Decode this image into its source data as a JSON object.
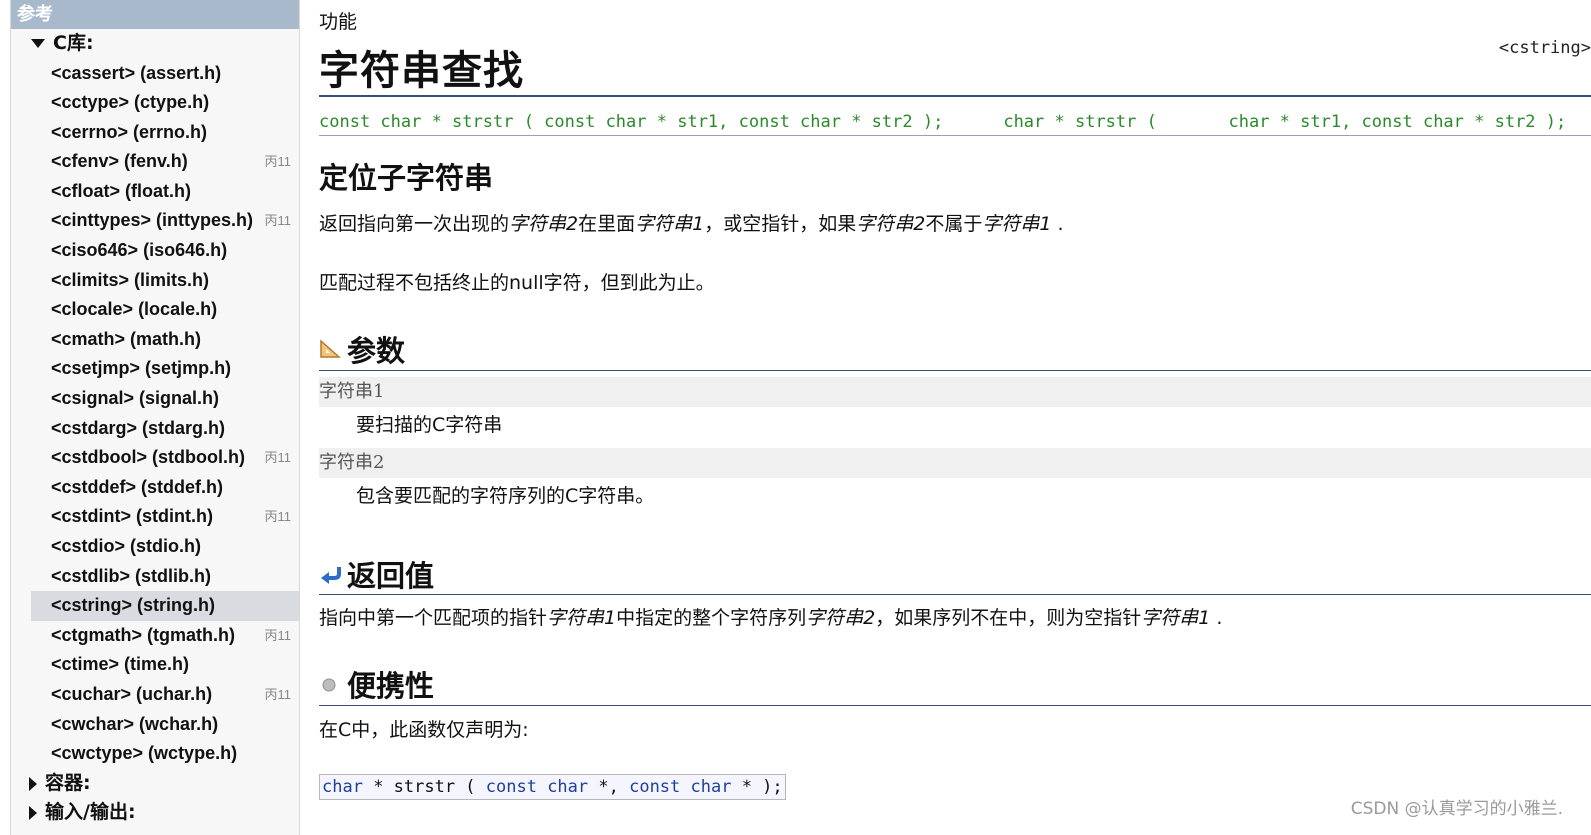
{
  "sidebar": {
    "header": "参考",
    "group_clib": "C库:",
    "items": [
      {
        "label": "<cassert> (assert.h)",
        "badge": ""
      },
      {
        "label": "<cctype> (ctype.h)",
        "badge": ""
      },
      {
        "label": "<cerrno> (errno.h)",
        "badge": ""
      },
      {
        "label": "<cfenv> (fenv.h)",
        "badge": "丙11"
      },
      {
        "label": "<cfloat> (float.h)",
        "badge": ""
      },
      {
        "label": "<cinttypes> (inttypes.h)",
        "badge": "丙11"
      },
      {
        "label": "<ciso646> (iso646.h)",
        "badge": ""
      },
      {
        "label": "<climits> (limits.h)",
        "badge": ""
      },
      {
        "label": "<clocale> (locale.h)",
        "badge": ""
      },
      {
        "label": "<cmath> (math.h)",
        "badge": ""
      },
      {
        "label": "<csetjmp> (setjmp.h)",
        "badge": ""
      },
      {
        "label": "<csignal> (signal.h)",
        "badge": ""
      },
      {
        "label": "<cstdarg> (stdarg.h)",
        "badge": ""
      },
      {
        "label": "<cstdbool> (stdbool.h)",
        "badge": "丙11"
      },
      {
        "label": "<cstddef> (stddef.h)",
        "badge": ""
      },
      {
        "label": "<cstdint> (stdint.h)",
        "badge": "丙11"
      },
      {
        "label": "<cstdio> (stdio.h)",
        "badge": ""
      },
      {
        "label": "<cstdlib> (stdlib.h)",
        "badge": ""
      },
      {
        "label": "<cstring> (string.h)",
        "badge": ""
      },
      {
        "label": "<ctgmath> (tgmath.h)",
        "badge": "丙11"
      },
      {
        "label": "<ctime> (time.h)",
        "badge": ""
      },
      {
        "label": "<cuchar> (uchar.h)",
        "badge": "丙11"
      },
      {
        "label": "<cwchar> (wchar.h)",
        "badge": ""
      },
      {
        "label": "<cwctype> (wctype.h)",
        "badge": ""
      }
    ],
    "active_item": "<cstring> (string.h)",
    "group_containers": "容器:",
    "group_io": "输入/输出:"
  },
  "main": {
    "kind": "功能",
    "title": "字符串查找",
    "header": "<cstring>",
    "prototype_c": "const char * strstr ( const char * str1, const char * str2 );",
    "prototype_cpp": "char * strstr (       char * str1, const char * str2 );",
    "subtitle": "定位子字符串",
    "desc1": {
      "p1": "返回指向第一次出现的",
      "i1": "字符串2",
      "p2": "在里面",
      "i2": "字符串1",
      "p3": "，或空指针，如果",
      "i3": "字符串2",
      "p4": "不属于",
      "i4": "字符串1",
      "p5": " ."
    },
    "desc2": "匹配过程不包括终止的null字符，但到此为止。",
    "params": {
      "title": "参数",
      "items": [
        {
          "term": "字符串1",
          "desc": "要扫描的C字符串"
        },
        {
          "term": "字符串2",
          "desc": "包含要匹配的字符序列的C字符串。"
        }
      ]
    },
    "returns": {
      "title": "返回值",
      "p1": "指向中第一个匹配项的指针",
      "i1": "字符串1",
      "p2": "中指定的整个字符序列",
      "i2": "字符串2",
      "p3": "，如果序列不在中，则为空指针",
      "i3": "字符串1",
      "p4": " ."
    },
    "portability": {
      "title": "便携性",
      "text": "在C中，此函数仅声明为:",
      "decl": {
        "t1": "char",
        "t2": " * strstr ( ",
        "t3": "const char",
        "t4": " *, ",
        "t5": "const char",
        "t6": " * );"
      }
    }
  },
  "watermark": "CSDN @认真学习的小雅兰.",
  "colors": {
    "sidebar_header_bg": "#a9b9cc",
    "rule": "#3d4c78",
    "prototype_green": "#2a8a2a",
    "active_item_bg": "#d9dbe0"
  }
}
